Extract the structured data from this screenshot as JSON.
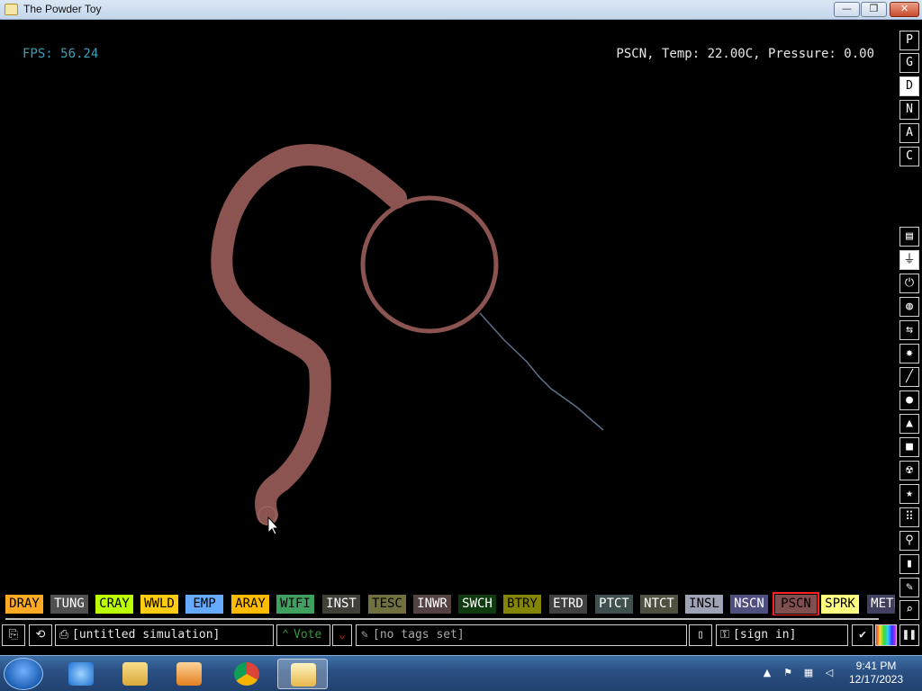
{
  "window": {
    "title": "The Powder Toy",
    "min_label": "—",
    "max_label": "❐",
    "close_label": "✕"
  },
  "hud": {
    "fps": "FPS: 56.24",
    "info": "PSCN, Temp: 22.00C, Pressure: 0.00"
  },
  "right_toolbar": {
    "render_modes": [
      "P",
      "G",
      "D",
      "N",
      "A",
      "C"
    ],
    "selected_mode": "D",
    "categories": [
      "walls-icon",
      "electronics-icon",
      "powered-icon",
      "sensors-icon",
      "force-icon",
      "explosives-icon",
      "gases-icon",
      "liquids-icon",
      "powders-icon",
      "solids-icon",
      "radioactive-icon",
      "special-icon",
      "life-icon",
      "tools-icon",
      "favorites-icon",
      "decoration-icon",
      "search-icon"
    ]
  },
  "elements": [
    {
      "name": "DRAY",
      "bg": "#ffaa22",
      "fg": "#000000"
    },
    {
      "name": "TUNG",
      "bg": "#505050",
      "fg": "#ffffff"
    },
    {
      "name": "CRAY",
      "bg": "#bbff00",
      "fg": "#000000"
    },
    {
      "name": "WWLD",
      "bg": "#ffcc11",
      "fg": "#000000"
    },
    {
      "name": "EMP",
      "bg": "#66aaff",
      "fg": "#000000"
    },
    {
      "name": "ARAY",
      "bg": "#ffbb00",
      "fg": "#000000"
    },
    {
      "name": "WIFI",
      "bg": "#40a060",
      "fg": "#000000"
    },
    {
      "name": "INST",
      "bg": "#404039",
      "fg": "#ffffff"
    },
    {
      "name": "TESC",
      "bg": "#707040",
      "fg": "#000000"
    },
    {
      "name": "INWR",
      "bg": "#544141",
      "fg": "#ffffff"
    },
    {
      "name": "SWCH",
      "bg": "#103b11",
      "fg": "#ffffff"
    },
    {
      "name": "BTRY",
      "bg": "#858505",
      "fg": "#000000"
    },
    {
      "name": "ETRD",
      "bg": "#404040",
      "fg": "#ffffff"
    },
    {
      "name": "PTCT",
      "bg": "#405050",
      "fg": "#ffffff"
    },
    {
      "name": "NTCT",
      "bg": "#505040",
      "fg": "#ffffff"
    },
    {
      "name": "INSL",
      "bg": "#9ea3b6",
      "fg": "#000000"
    },
    {
      "name": "NSCN",
      "bg": "#505080",
      "fg": "#ffffff"
    },
    {
      "name": "PSCN",
      "bg": "#805050",
      "fg": "#000000"
    },
    {
      "name": "SPRK",
      "bg": "#ffff80",
      "fg": "#000000"
    },
    {
      "name": "METL",
      "bg": "#404060",
      "fg": "#ffffff"
    }
  ],
  "selected_element": "PSCN",
  "bottom": {
    "sim_name": "[untitled simulation]",
    "vote": "Vote",
    "tags": "[no tags set]",
    "sign_in": "[sign in]"
  },
  "taskbar": {
    "time": "9:41 PM",
    "date": "12/17/2023"
  },
  "colors": {
    "pscn": "#8b5450",
    "spark_trail": "#5d6f8a",
    "fps": "#3aa0b6",
    "vote_green": "#2f9a3a",
    "vote_red": "#c02020"
  }
}
